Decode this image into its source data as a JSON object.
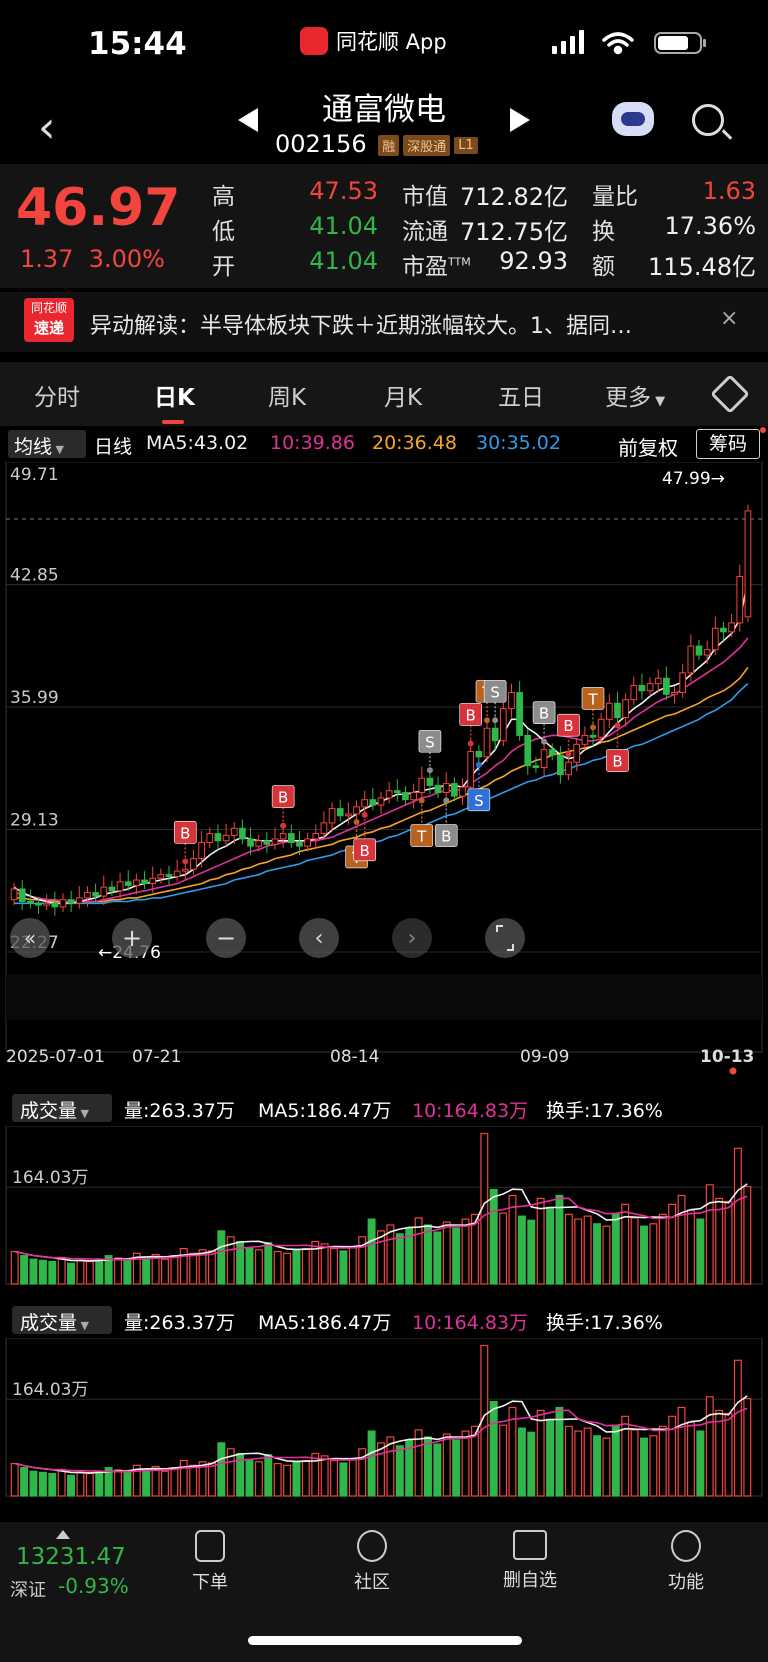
{
  "status_bar": {
    "time": "15:44",
    "app_name": "同花顺 App"
  },
  "header": {
    "stock_name": "通富微电",
    "stock_code": "002156",
    "tags": [
      "融",
      "深股通",
      "L1"
    ]
  },
  "quote": {
    "last_price": "46.97",
    "change": "1.37",
    "change_pct": "3.00%",
    "high_label": "高",
    "high": "47.53",
    "low_label": "低",
    "low": "41.04",
    "open_label": "开",
    "open": "41.04",
    "mcap_label": "市值",
    "mcap": "712.82亿",
    "float_label": "流通",
    "float_mcap": "712.75亿",
    "pe_label": "市盈",
    "pe_sup": "TTM",
    "pe": "92.93",
    "vol_ratio_label": "量比",
    "vol_ratio": "1.63",
    "turnover_label": "换",
    "turnover": "17.36%",
    "amount_label": "额",
    "amount": "115.48亿"
  },
  "news": {
    "logo_top": "同花顺",
    "logo_bottom": "速递",
    "text": "异动解读：半导体板块下跌＋近期涨幅较大。1、据同…",
    "close": "×"
  },
  "tabs": [
    "分时",
    "日K",
    "周K",
    "月K",
    "五日",
    "更多"
  ],
  "ma_row": {
    "select": "均线",
    "period": "日线",
    "ma5": "MA5:43.02",
    "ma10": "10:39.86",
    "ma20": "20:36.48",
    "ma30": "30:35.02",
    "adjust": "前复权",
    "chips": "筹码"
  },
  "colors": {
    "up": "#f2453d",
    "down": "#2fb74a",
    "ma5": "#f0f0f0",
    "ma10": "#e0309a",
    "ma20": "#f5a623",
    "ma30": "#2f9bea"
  },
  "chart_data": {
    "type": "candlestick",
    "y_ticks": [
      "49.71",
      "42.85",
      "35.99",
      "29.13",
      "22.27"
    ],
    "ylim": [
      22.27,
      49.71
    ],
    "high_label": "47.99→",
    "low_label": "←24.76",
    "x_ticks": [
      "2025-07-01",
      "07-21",
      "08-14",
      "09-09",
      "10-13"
    ],
    "close": [
      25.8,
      25.1,
      25.0,
      24.9,
      25.0,
      24.8,
      25.2,
      25.0,
      25.3,
      25.6,
      25.4,
      25.9,
      25.7,
      26.2,
      26.0,
      26.3,
      26.1,
      26.4,
      26.6,
      26.5,
      26.8,
      26.9,
      27.5,
      28.4,
      28.9,
      28.5,
      28.8,
      29.2,
      28.6,
      28.2,
      28.5,
      28.3,
      28.6,
      28.9,
      28.4,
      28.2,
      28.6,
      28.9,
      29.5,
      30.3,
      29.9,
      30.0,
      30.4,
      30.8,
      30.5,
      30.9,
      31.3,
      31.2,
      30.8,
      31.2,
      32.0,
      31.6,
      31.2,
      31.7,
      31.0,
      31.5,
      33.5,
      33.2,
      34.8,
      34.1,
      35.9,
      36.8,
      34.4,
      32.7,
      32.6,
      33.6,
      33.3,
      32.2,
      32.9,
      33.9,
      34.4,
      34.3,
      35.3,
      36.2,
      35.4,
      36.4,
      37.2,
      36.9,
      37.3,
      37.6,
      36.7,
      36.8,
      37.9,
      39.4,
      38.9,
      39.2,
      40.4,
      40.2,
      40.7,
      43.3,
      46.97
    ],
    "open": [
      25.2,
      25.8,
      25.1,
      25.0,
      24.9,
      25.0,
      24.8,
      25.2,
      25.0,
      25.3,
      25.6,
      25.4,
      25.9,
      25.7,
      26.2,
      26.0,
      26.3,
      26.1,
      26.4,
      26.6,
      26.5,
      26.8,
      26.9,
      27.5,
      28.4,
      28.9,
      28.5,
      28.8,
      29.2,
      28.6,
      28.2,
      28.5,
      28.3,
      28.6,
      28.9,
      28.4,
      28.2,
      28.6,
      28.9,
      29.5,
      30.3,
      29.9,
      30.0,
      30.4,
      30.8,
      30.5,
      30.9,
      31.3,
      31.2,
      30.8,
      31.2,
      32.0,
      31.6,
      31.2,
      31.7,
      31.0,
      31.5,
      33.5,
      33.2,
      34.8,
      34.1,
      35.9,
      36.8,
      34.4,
      32.7,
      32.6,
      33.6,
      33.3,
      32.2,
      32.9,
      33.9,
      34.4,
      34.3,
      35.3,
      36.2,
      35.4,
      36.4,
      37.2,
      36.9,
      37.3,
      37.6,
      36.7,
      36.8,
      37.9,
      39.4,
      38.9,
      39.2,
      40.4,
      40.2,
      40.7,
      41.04
    ],
    "ma5": [
      25.9,
      25.6,
      25.4,
      25.2,
      25.1,
      25.0,
      25.0,
      25.0,
      25.1,
      25.2,
      25.3,
      25.5,
      25.6,
      25.7,
      25.8,
      26.0,
      26.1,
      26.2,
      26.3,
      26.4,
      26.5,
      26.6,
      26.9,
      27.3,
      27.7,
      28.0,
      28.2,
      28.5,
      28.7,
      28.6,
      28.5,
      28.5,
      28.5,
      28.5,
      28.5,
      28.5,
      28.5,
      28.6,
      28.7,
      29.1,
      29.4,
      29.7,
      30.0,
      30.3,
      30.5,
      30.7,
      30.9,
      31.1,
      31.1,
      31.2,
      31.3,
      31.4,
      31.5,
      31.6,
      31.6,
      31.5,
      32.1,
      32.6,
      33.1,
      33.6,
      34.5,
      35.3,
      35.3,
      34.8,
      34.5,
      34.1,
      33.7,
      33.3,
      33.1,
      33.2,
      33.6,
      33.8,
      34.1,
      34.6,
      35.1,
      35.5,
      35.9,
      36.2,
      36.6,
      36.9,
      37.1,
      37.2,
      37.4,
      37.8,
      38.2,
      38.6,
      39.3,
      39.7,
      40.1,
      40.9,
      43.02
    ],
    "ma10": [
      25.6,
      25.5,
      25.4,
      25.3,
      25.2,
      25.2,
      25.1,
      25.1,
      25.1,
      25.1,
      25.1,
      25.2,
      25.3,
      25.4,
      25.5,
      25.6,
      25.7,
      25.8,
      25.9,
      26.0,
      26.1,
      26.3,
      26.5,
      26.7,
      26.9,
      27.1,
      27.3,
      27.5,
      27.7,
      27.9,
      28.0,
      28.2,
      28.3,
      28.4,
      28.5,
      28.5,
      28.5,
      28.5,
      28.6,
      28.7,
      28.9,
      29.1,
      29.3,
      29.5,
      29.7,
      29.9,
      30.1,
      30.3,
      30.5,
      30.7,
      30.9,
      31.0,
      31.2,
      31.3,
      31.3,
      31.4,
      31.7,
      32.0,
      32.3,
      32.7,
      33.0,
      33.5,
      33.8,
      34.0,
      34.2,
      34.3,
      34.4,
      34.4,
      34.3,
      34.2,
      34.1,
      34.1,
      34.2,
      34.4,
      34.7,
      35.0,
      35.4,
      35.7,
      36.0,
      36.3,
      36.5,
      36.7,
      37.0,
      37.3,
      37.6,
      37.9,
      38.2,
      38.5,
      38.9,
      39.3,
      39.86
    ],
    "ma20": [
      25.3,
      25.3,
      25.2,
      25.2,
      25.2,
      25.1,
      25.1,
      25.1,
      25.1,
      25.1,
      25.1,
      25.1,
      25.2,
      25.2,
      25.3,
      25.3,
      25.4,
      25.5,
      25.6,
      25.7,
      25.8,
      25.9,
      26.0,
      26.1,
      26.3,
      26.4,
      26.6,
      26.7,
      26.9,
      27.0,
      27.2,
      27.3,
      27.5,
      27.6,
      27.7,
      27.9,
      28.0,
      28.1,
      28.2,
      28.3,
      28.5,
      28.6,
      28.7,
      28.9,
      29.0,
      29.2,
      29.3,
      29.5,
      29.7,
      29.9,
      30.1,
      30.2,
      30.4,
      30.6,
      30.8,
      31.0,
      31.2,
      31.4,
      31.6,
      31.9,
      32.1,
      32.4,
      32.6,
      32.8,
      33.0,
      33.1,
      33.3,
      33.4,
      33.5,
      33.6,
      33.7,
      33.8,
      34.0,
      34.1,
      34.3,
      34.5,
      34.7,
      34.9,
      35.1,
      35.3,
      35.5,
      35.6,
      35.8,
      36.0,
      36.2,
      36.5,
      36.7,
      36.9,
      37.2,
      37.6,
      38.2
    ],
    "ma30": [
      25.0,
      25.0,
      25.0,
      25.0,
      25.0,
      25.0,
      25.0,
      25.0,
      25.0,
      25.0,
      25.0,
      25.0,
      25.1,
      25.1,
      25.1,
      25.2,
      25.2,
      25.3,
      25.3,
      25.4,
      25.5,
      25.6,
      25.7,
      25.8,
      25.9,
      26.0,
      26.1,
      26.3,
      26.4,
      26.5,
      26.6,
      26.8,
      26.9,
      27.0,
      27.1,
      27.2,
      27.4,
      27.5,
      27.6,
      27.7,
      27.9,
      28.0,
      28.1,
      28.3,
      28.4,
      28.5,
      28.7,
      28.8,
      29.0,
      29.2,
      29.3,
      29.5,
      29.7,
      29.9,
      30.0,
      30.2,
      30.4,
      30.6,
      30.8,
      31.0,
      31.2,
      31.4,
      31.6,
      31.8,
      31.9,
      32.1,
      32.2,
      32.4,
      32.5,
      32.7,
      32.8,
      33.0,
      33.1,
      33.3,
      33.4,
      33.6,
      33.8,
      33.9,
      34.1,
      34.3,
      34.5,
      34.7,
      34.9,
      35.1,
      35.3,
      35.6,
      35.8,
      36.1,
      36.4,
      36.9,
      37.3
    ],
    "signals": [
      {
        "i": 21,
        "label": "B",
        "kind": "buy",
        "pos": "above"
      },
      {
        "i": 33,
        "label": "B",
        "kind": "buy",
        "pos": "above"
      },
      {
        "i": 42,
        "label": "T",
        "kind": "t",
        "pos": "below"
      },
      {
        "i": 43,
        "label": "B",
        "kind": "buy",
        "pos": "below"
      },
      {
        "i": 50,
        "label": "T",
        "kind": "t",
        "pos": "below"
      },
      {
        "i": 51,
        "label": "S",
        "kind": "sell-gray",
        "pos": "above"
      },
      {
        "i": 53,
        "label": "B",
        "kind": "buy-gray",
        "pos": "below"
      },
      {
        "i": 56,
        "label": "B",
        "kind": "buy",
        "pos": "above"
      },
      {
        "i": 57,
        "label": "S",
        "kind": "sell-blue",
        "pos": "below"
      },
      {
        "i": 58,
        "label": "T",
        "kind": "t",
        "pos": "above"
      },
      {
        "i": 59,
        "label": "S",
        "kind": "sell-gray",
        "pos": "above"
      },
      {
        "i": 65,
        "label": "B",
        "kind": "buy-gray",
        "pos": "above"
      },
      {
        "i": 68,
        "label": "B",
        "kind": "buy",
        "pos": "above"
      },
      {
        "i": 71,
        "label": "T",
        "kind": "t",
        "pos": "above"
      },
      {
        "i": 74,
        "label": "B",
        "kind": "buy",
        "pos": "below"
      }
    ]
  },
  "volume_panel": {
    "select": "成交量",
    "vol": "量:263.37万",
    "ma5": "MA5:186.47万",
    "ma10": "10:164.83万",
    "turnover": "换手:17.36%",
    "tick": "164.03万",
    "values": [
      55,
      48,
      42,
      40,
      38,
      45,
      35,
      40,
      38,
      42,
      48,
      44,
      40,
      52,
      46,
      50,
      42,
      48,
      60,
      52,
      58,
      56,
      90,
      80,
      72,
      62,
      58,
      70,
      55,
      52,
      58,
      60,
      72,
      68,
      60,
      56,
      62,
      80,
      110,
      90,
      100,
      85,
      95,
      112,
      100,
      88,
      105,
      95,
      110,
      118,
      255,
      160,
      120,
      150,
      115,
      108,
      145,
      130,
      150,
      118,
      110,
      115,
      102,
      98,
      120,
      135,
      112,
      98,
      102,
      118,
      135,
      150,
      125,
      110,
      168,
      145,
      140,
      230,
      165
    ]
  },
  "bottom_bar": {
    "index_value": "13231.47",
    "index_name": "深证",
    "index_change": "-0.93%",
    "nav": [
      "下单",
      "社区",
      "删自选",
      "功能"
    ]
  }
}
